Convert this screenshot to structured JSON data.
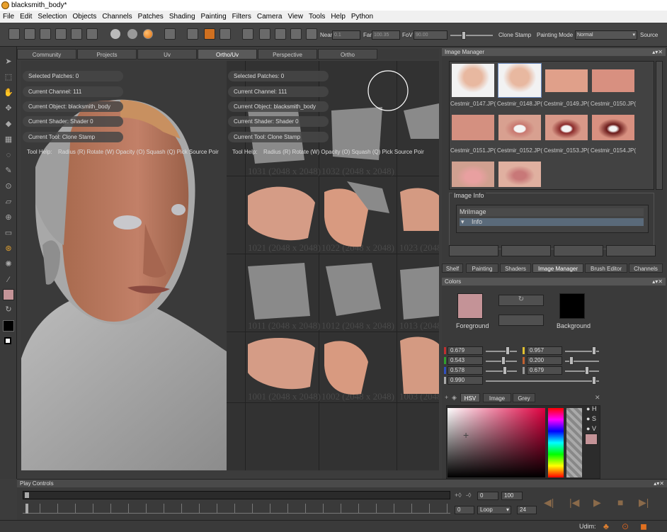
{
  "window": {
    "title": "blacksmith_body*"
  },
  "menu": [
    "File",
    "Edit",
    "Selection",
    "Objects",
    "Channels",
    "Patches",
    "Shading",
    "Painting",
    "Filters",
    "Camera",
    "View",
    "Tools",
    "Help",
    "Python"
  ],
  "toolbar": {
    "near_label": "Near",
    "near_value": "0.1",
    "far_label": "Far",
    "far_value": "100.35",
    "fov_label": "FoV",
    "fov_value": "90.00",
    "clone_stamp_label": "Clone Stamp",
    "painting_mode_label": "Painting Mode",
    "painting_mode_value": "Normal",
    "source_label": "Source"
  },
  "viewport_tabs": [
    "Community",
    "Projects",
    "Uv",
    "Ortho/Uv",
    "Perspective",
    "Ortho"
  ],
  "active_tab": "Ortho/Uv",
  "info": {
    "selected_patches": "Selected Patches: 0",
    "current_channel": "Current Channel: 111",
    "current_object": "Current Object: blacksmith_body",
    "current_shader": "Current Shader: Shader 0",
    "current_tool": "Current Tool: Clone Stamp",
    "tool_help": "Tool Help:",
    "help_items": "Radius (R)   Rotate (W)   Opacity (O)   Squash (Q)   Pick Source Poir"
  },
  "udim_labels": {
    "r1a": "1031 (2048 x 2048)",
    "r1b": "1032 (2048 x 2048)",
    "r2a": "1021 (2048 x 2048)",
    "r2b": "1022 (2048 x 2048)",
    "r2c": "1023 (2048 x 2048)",
    "r3a": "1011 (2048 x 2048)",
    "r3b": "1012 (2048 x 2048)",
    "r3c": "1013 (2048 x 2048)",
    "r4a": "1001 (2048 x 2048)",
    "r4b": "1002 (2048 x 2048)",
    "r4c": "1003 (2048 x 2048)"
  },
  "image_manager": {
    "title": "Image Manager",
    "images": [
      "Cestmir_0147.JP(",
      "Cestmir_0148.JP(",
      "Cestmir_0149.JP(",
      "Cestmir_0150.JP(",
      "Cestmir_0151.JP(",
      "Cestmir_0152.JP(",
      "Cestmir_0153.JP(",
      "Cestmir_0154.JP("
    ],
    "image_info_label": "Image Info",
    "tree_root": "MriImage",
    "tree_child": "Info"
  },
  "panel_tabs": [
    "Shelf",
    "Painting",
    "Shaders",
    "Image Manager",
    "Brush Editor",
    "Channels"
  ],
  "active_panel_tab": "Image Manager",
  "colors": {
    "title": "Colors",
    "foreground_label": "Foreground",
    "background_label": "Background",
    "foreground_hex": "#c49397",
    "background_hex": "#000000",
    "r": "0.679",
    "g": "0.543",
    "b": "0.578",
    "a": "0.990",
    "h": "0.957",
    "s": "0.200",
    "v": "0.679",
    "tabs": [
      "HSV",
      "Image",
      "Grey"
    ],
    "active_tab": "HSV",
    "hsv_labels": [
      "H",
      "S",
      "V"
    ]
  },
  "play": {
    "title": "Play Controls",
    "start": "0",
    "end": "100",
    "frame": "0",
    "loop_value": "Loop",
    "fps": "24"
  },
  "status": {
    "udim_label": "Udim:"
  }
}
